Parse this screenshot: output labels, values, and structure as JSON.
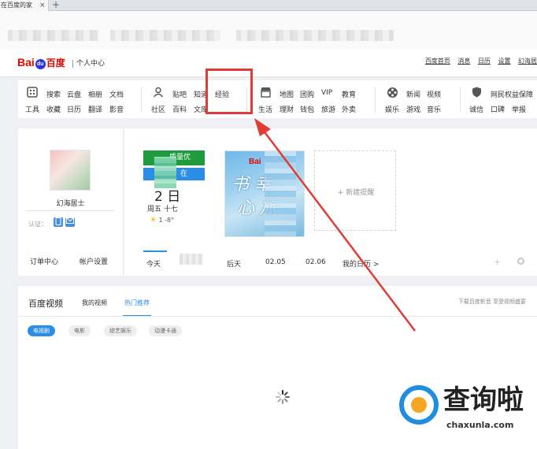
{
  "browser": {
    "tab_title": "在百度的家",
    "tab_close": "×",
    "new_tab": "+"
  },
  "header": {
    "logo_prefix": "Bai",
    "logo_paw": "du",
    "logo_cn": "百度",
    "center_label": "个人中心",
    "links": [
      "百度首页",
      "消息",
      "日历",
      "设置",
      "幻海居"
    ]
  },
  "apps": {
    "groups": [
      {
        "icon": "grid-icon",
        "row1": [
          "搜索",
          "云盘",
          "相册",
          "文档"
        ],
        "row2": [
          "工具",
          "收藏",
          "日历",
          "翻译",
          "影音"
        ]
      },
      {
        "icon": "user-icon",
        "row1": [
          "贴吧",
          "知道",
          "经验"
        ],
        "row2": [
          "社区",
          "百科",
          "文库"
        ]
      },
      {
        "icon": "store-icon",
        "row1": [
          "地图",
          "团购",
          "VIP",
          "教育"
        ],
        "row2": [
          "生活",
          "理财",
          "钱包",
          "旅游",
          "外卖"
        ]
      },
      {
        "icon": "film-icon",
        "row1": [
          "新闻",
          "视频"
        ],
        "row2": [
          "娱乐",
          "游戏",
          "音乐"
        ]
      },
      {
        "icon": "shield-icon",
        "row1": [
          "网民权益保障"
        ],
        "row2": [
          "诚信",
          "口碑",
          "举报"
        ]
      }
    ]
  },
  "profile": {
    "username": "幻海居士",
    "verify_label": "认证：",
    "order_center": "订单中心",
    "account_settings": "帐户设置"
  },
  "calendar": {
    "air_quality": "质量优",
    "status": "在",
    "day_num": "2  日",
    "weekday": "周五      十七",
    "temp": "1    -8°",
    "new_reminder": "+ 新建提醒",
    "tabs": [
      "今天",
      "后天",
      "02.05",
      "02.06",
      "我的日历 >"
    ],
    "card_brand": "Bai",
    "card_art": "书  幸\n  心  旅"
  },
  "video": {
    "title": "百度视频",
    "tabs": [
      "我的视频",
      "热门推荐"
    ],
    "active_tab": 1,
    "right_text": "下载百度影音 享受视频盛宴",
    "chips": [
      "电视剧",
      "电影",
      "综艺娱乐",
      "动漫卡通"
    ],
    "active_chip": 0
  },
  "watermark": {
    "text": "查询啦",
    "domain": "chaxunla.com"
  },
  "colors": {
    "highlight": "#e03b36",
    "accent": "#2a8ee6",
    "baidu_red": "#e10601",
    "baidu_blue": "#2932e1"
  }
}
